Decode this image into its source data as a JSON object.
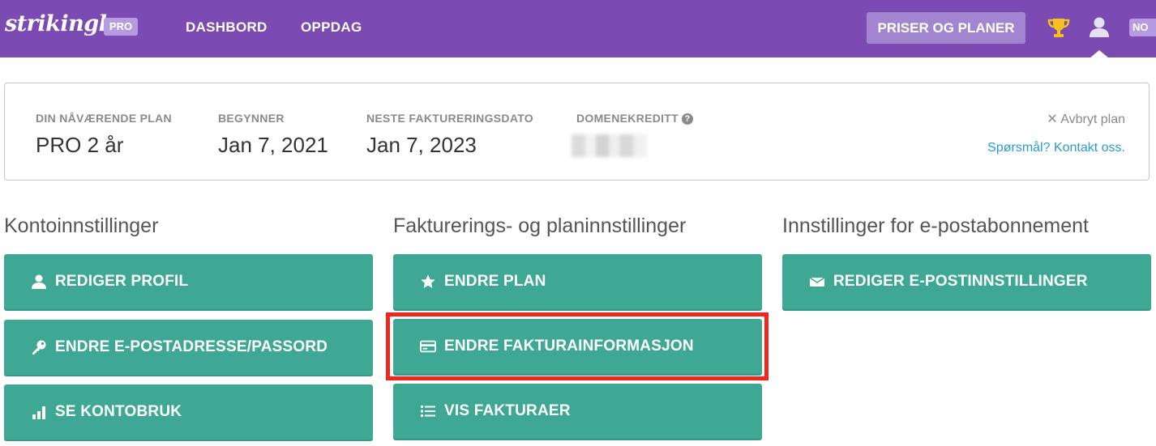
{
  "nav": {
    "logo": "strikingly",
    "badge": "PRO",
    "links": [
      "DASHBORD",
      "OPPDAG"
    ],
    "pricing_button": "PRISER OG PLANER",
    "language": "NO",
    "icons": [
      "trophy-icon",
      "user-icon"
    ]
  },
  "plan": {
    "current_plan_label": "DIN NÅVÆRENDE PLAN",
    "current_plan_value": "PRO 2 år",
    "start_label": "BEGYNNER",
    "start_value": "Jan 7, 2021",
    "next_billing_label": "NESTE FAKTURERINGSDATO",
    "next_billing_value": "Jan 7, 2023",
    "domain_credit_label": "DOMENEKREDITT",
    "cancel_label": "Avbryt plan",
    "contact_label": "Spørsmål? Kontakt oss."
  },
  "sections": {
    "account": {
      "title": "Kontoinnstillinger",
      "buttons": [
        "REDIGER PROFIL",
        "ENDRE E-POSTADRESSE/PASSORD",
        "SE KONTOBRUK"
      ]
    },
    "billing": {
      "title": "Fakturerings- og planinnstillinger",
      "buttons": [
        "ENDRE PLAN",
        "ENDRE FAKTURAINFORMASJON",
        "VIS FAKTURAER"
      ]
    },
    "email": {
      "title": "Innstillinger for e-postabonnement",
      "buttons": [
        "REDIGER E-POSTINNSTILLINGER"
      ]
    }
  },
  "colors": {
    "nav_bg": "#7b4bb3",
    "button_bg": "#3ea895",
    "highlight": "#f0271c",
    "link": "#2b9bd4"
  }
}
